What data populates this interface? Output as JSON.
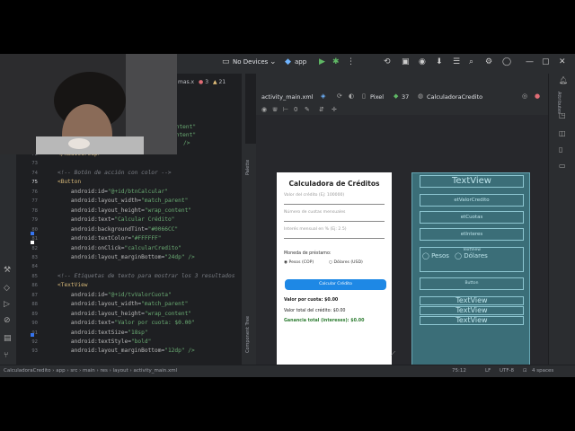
{
  "toolbar": {
    "device": "No Devices",
    "run_config": "app"
  },
  "editor": {
    "tab_fragment": "mas.x",
    "error_count": "3",
    "warning_count": "21",
    "lines": [
      {
        "n": "",
        "text": "ontent\""
      },
      {
        "n": "",
        "text": "ontent\""
      },
      {
        "n": "",
        "text": "/>"
      },
      {
        "n": "72",
        "text": "</RadioGroup>"
      },
      {
        "n": "73",
        "text": ""
      },
      {
        "n": "74",
        "text": "<!-- Botón de acción con color -->"
      },
      {
        "n": "75",
        "text": "<Button"
      },
      {
        "n": "76",
        "text": "    android:id=\"@+id/btnCalcular\""
      },
      {
        "n": "77",
        "text": "    android:layout_width=\"match_parent\""
      },
      {
        "n": "78",
        "text": "    android:layout_height=\"wrap_content\""
      },
      {
        "n": "79",
        "text": "    android:text=\"Calcular Crédito\""
      },
      {
        "n": "80",
        "text": "    android:backgroundTint=\"#0066CC\""
      },
      {
        "n": "81",
        "text": "    android:textColor=\"#FFFFFF\""
      },
      {
        "n": "82",
        "text": "    android:onClick=\"calcularCredito\""
      },
      {
        "n": "83",
        "text": "    android:layout_marginBottom=\"24dp\" />"
      },
      {
        "n": "84",
        "text": ""
      },
      {
        "n": "85",
        "text": "<!-- Etiquetas de texto para mostrar los 3 resultados"
      },
      {
        "n": "86",
        "text": "<TextView"
      },
      {
        "n": "87",
        "text": "    android:id=\"@+id/tvValorCuota\""
      },
      {
        "n": "88",
        "text": "    android:layout_width=\"match_parent\""
      },
      {
        "n": "89",
        "text": "    android:layout_height=\"wrap_content\""
      },
      {
        "n": "90",
        "text": "    android:text=\"Valor por cuota: $0.00\""
      },
      {
        "n": "91",
        "text": "    android:textSize=\"18sp\""
      },
      {
        "n": "92",
        "text": "    android:textStyle=\"bold\""
      },
      {
        "n": "93",
        "text": "    android:layout_marginBottom=\"12dp\" />"
      }
    ]
  },
  "designer": {
    "file_tab": "activity_main.xml",
    "device": "Pixel",
    "api": "37",
    "theme": "CalculadoraCredito"
  },
  "phone": {
    "title": "Calculadora de Créditos",
    "input_valor": "Valor del crédito (Ej: 100000)",
    "input_cuotas": "Número de cuotas mensuales",
    "input_interes": "Interés mensual en % (Ej: 2.5)",
    "moneda_label": "Moneda de préstamo:",
    "radio_pesos": "Pesos (COP)",
    "radio_dolares": "Dólares (USD)",
    "btn_calcular": "Calcular Crédito",
    "out_cuota": "Valor por cuota: $0.00",
    "out_total": "Valor total del crédito: $0.00",
    "out_ganancia": "Ganancia total (intereses): $0.00"
  },
  "blueprint": {
    "title": "TextView",
    "b_valor": "etValorCredito",
    "b_cuotas": "etCuotas",
    "b_interes": "etInteres",
    "b_group": "TextView",
    "b_pesos": "Pesos",
    "b_dolares": "Dólares",
    "b_button": "Button",
    "b_tv1": "TextView",
    "b_tv2": "TextView",
    "b_tv3": "TextView"
  },
  "tool_windows": {
    "left_tab": "Palette",
    "left_tab2": "Component Tree",
    "right_tab": "Attributes"
  },
  "statusbar": {
    "breadcrumb": [
      "CalculadoraCredito",
      "app",
      "src",
      "main",
      "res",
      "layout",
      "activity_main.xml"
    ],
    "position": "75:12",
    "line_ending": "LF",
    "encoding": "UTF-8",
    "indent": "4 spaces"
  },
  "colors": {
    "accent_button": "#1e88e5",
    "blueprint_bg": "#3b6e78",
    "ide_bg": "#1e1f22"
  }
}
